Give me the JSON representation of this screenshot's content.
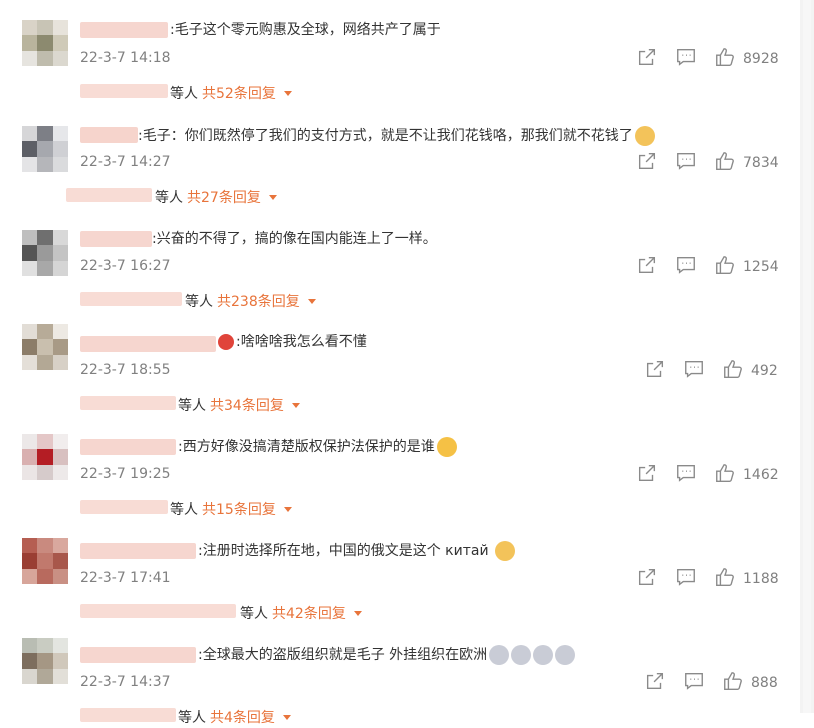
{
  "comments": [
    {
      "text": ":毛子这个零元购惠及全球，网络共产了属于",
      "time": "22-3-7 14:18",
      "likes": "8928",
      "etc": "等人",
      "more": "共52条回复"
    },
    {
      "text": ":毛子：你们既然停了我们的支付方式，就是不让我们花钱咯，那我们就不花钱了",
      "time": "22-3-7 14:27",
      "likes": "7834",
      "etc": "等人",
      "more": "共27条回复"
    },
    {
      "text": ":兴奋的不得了，搞的像在国内能连上了一样。",
      "time": "22-3-7 16:27",
      "likes": "1254",
      "etc": "等人",
      "more": "共238条回复"
    },
    {
      "text": ":啥啥啥我怎么看不懂",
      "time": "22-3-7 18:55",
      "likes": "492",
      "etc": "等人",
      "more": "共34条回复"
    },
    {
      "text": ":西方好像没搞清楚版权保护法保护的是谁",
      "time": "22-3-7 19:25",
      "likes": "1462",
      "etc": "等人",
      "more": "共15条回复"
    },
    {
      "text": ":注册时选择所在地，中国的俄文是这个 китай",
      "time": "22-3-7 17:41",
      "likes": "1188",
      "etc": "等人",
      "more": "共42条回复"
    },
    {
      "text": ":全球最大的盗版组织就是毛子 外挂组织在欧洲",
      "time": "22-3-7 14:37",
      "likes": "888",
      "etc": "等人",
      "more": "共4条回复"
    }
  ],
  "icons": {
    "share": "share-icon",
    "comment": "comment-icon",
    "like": "thumbs-up-icon"
  },
  "colors": {
    "accent": "#e8743b",
    "meta": "#808080",
    "text": "#333333"
  }
}
